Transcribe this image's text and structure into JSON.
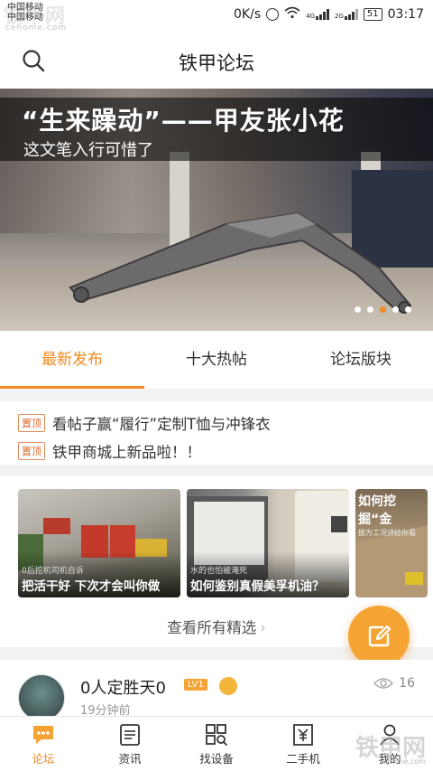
{
  "status_bar": {
    "carrier_1": "中国移动",
    "carrier_2": "中国移动",
    "speed": "0K/s",
    "sig1": "4G",
    "sig2": "2G",
    "battery": "51",
    "time": "03:17"
  },
  "watermark": {
    "top": "铁甲网",
    "top_url": "cehome.com",
    "bottom": "铁甲网",
    "bottom_url": "cehome.com"
  },
  "header": {
    "title": "铁甲论坛"
  },
  "banner": {
    "title": "“生来躁动”——甲友张小花",
    "subtitle": "这文笔入行可惜了",
    "slide_count": 5,
    "active_slide": 2
  },
  "tabs": [
    {
      "label": "最新发布",
      "active": true
    },
    {
      "label": "十大热帖",
      "active": false
    },
    {
      "label": "论坛版块",
      "active": false
    }
  ],
  "pinned": [
    {
      "badge": "置顶",
      "text": "看帖子赢“履行”定制T恤与冲锋衣"
    },
    {
      "badge": "置顶",
      "text": "铁甲商城上新品啦！！"
    }
  ],
  "featured": {
    "cards": [
      {
        "small": "0后挖机司机自诉",
        "big": "把活干好 下次才会叫你做"
      },
      {
        "small": "水的也怕被淹死",
        "big": "如何鉴别真假美孚机油？"
      },
      {
        "top_big": "如何挖掘“金",
        "top_small": "据为工况讲给你看"
      }
    ],
    "view_all": "查看所有精选"
  },
  "post": {
    "username": "0人定胜天0",
    "level": "LV1",
    "time": "19分钟前",
    "views": "16"
  },
  "bottom_nav": [
    {
      "label": "论坛",
      "icon": "forum-icon",
      "active": true
    },
    {
      "label": "资讯",
      "icon": "news-icon",
      "active": false
    },
    {
      "label": "找设备",
      "icon": "find-equipment-icon",
      "active": false
    },
    {
      "label": "二手机",
      "icon": "used-machine-icon",
      "active": false
    },
    {
      "label": "我的",
      "icon": "profile-icon",
      "active": false
    }
  ],
  "colors": {
    "accent": "#f08a22",
    "fab": "#f5a433"
  }
}
